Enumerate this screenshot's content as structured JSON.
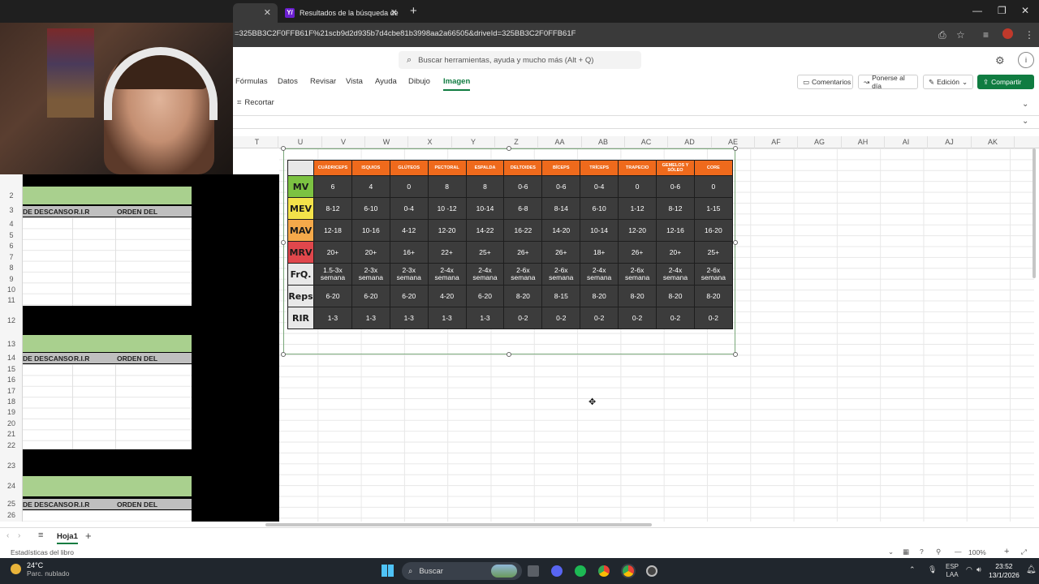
{
  "browser": {
    "tabs": [
      {
        "label": ""
      },
      {
        "label": "Resultados de la búsqueda de"
      }
    ],
    "url": "=325BB3C2F0FFB61F%21scb9d2d935b7d4cbe81b3998aa2a66505&driveId=325BB3C2F0FFB61F"
  },
  "excel": {
    "search_placeholder": "Buscar herramientas, ayuda y mucho más (Alt + Q)",
    "menu": [
      "Fórmulas",
      "Datos",
      "Revisar",
      "Vista",
      "Ayuda",
      "Dibujo",
      "Imagen"
    ],
    "buttons": {
      "comments": "Comentarios",
      "catchup": "Ponerse al día",
      "editing": "Edición",
      "share": "Compartir"
    },
    "crop": "Recortar",
    "columns": [
      "T",
      "U",
      "V",
      "W",
      "X",
      "Y",
      "Z",
      "AA",
      "AB",
      "AC",
      "AD",
      "AE",
      "AF",
      "AG",
      "AH",
      "AI",
      "AJ",
      "AK"
    ],
    "rows": [
      "2",
      "3",
      "4",
      "5",
      "6",
      "7",
      "8",
      "9",
      "10",
      "11",
      "12",
      "13",
      "14",
      "15",
      "16",
      "17",
      "18",
      "19",
      "20",
      "21",
      "22",
      "23",
      "24",
      "25",
      "26"
    ],
    "left_headers": {
      "descanso": "DE DESCANSO",
      "rir": "R.I.R",
      "orden": "ORDEN DEL EJERCICIO"
    },
    "sheet_tab": "Hoja1",
    "status_left": "Estadísticas del libro",
    "zoom": "100%"
  },
  "volume_table": {
    "headers": [
      "CUÁDRICEPS",
      "ISQUIOS",
      "GLÚTEOS",
      "PECTORAL",
      "ESPALDA",
      "DELTOIDES",
      "BÍCEPS",
      "TRÍCEPS",
      "TRAPECIO",
      "GEMELOS Y SÓLEO",
      "CORE"
    ],
    "rows": [
      {
        "label": "MV",
        "color": "#7cc242",
        "values": [
          "6",
          "4",
          "0",
          "8",
          "8",
          "0-6",
          "0-6",
          "0-4",
          "0",
          "0-6",
          "0"
        ]
      },
      {
        "label": "MEV",
        "color": "#f3e24a",
        "values": [
          "8-12",
          "6-10",
          "0-4",
          "10 -12",
          "10-14",
          "6-8",
          "8-14",
          "6-10",
          "1-12",
          "8-12",
          "1-15"
        ]
      },
      {
        "label": "MAV",
        "color": "#f5a94a",
        "values": [
          "12-18",
          "10-16",
          "4-12",
          "12-20",
          "14-22",
          "16-22",
          "14-20",
          "10-14",
          "12-20",
          "12-16",
          "16-20"
        ]
      },
      {
        "label": "MRV",
        "color": "#e0474c",
        "values": [
          "20+",
          "20+",
          "16+",
          "22+",
          "25+",
          "26+",
          "26+",
          "18+",
          "26+",
          "20+",
          "25+"
        ]
      },
      {
        "label": "FrQ.",
        "color": "#e8e8e8",
        "values": [
          "1.5-3x semana",
          "2-3x semana",
          "2-3x semana",
          "2-4x semana",
          "2-4x semana",
          "2-6x semana",
          "2-6x semana",
          "2-4x semana",
          "2-6x semana",
          "2-4x semana",
          "2-6x semana"
        ]
      },
      {
        "label": "Reps",
        "color": "#e8e8e8",
        "values": [
          "6-20",
          "6-20",
          "6-20",
          "4-20",
          "6-20",
          "8-20",
          "8-15",
          "8-20",
          "8-20",
          "8-20",
          "8-20"
        ]
      },
      {
        "label": "RIR",
        "color": "#e8e8e8",
        "values": [
          "1-3",
          "1-3",
          "1-3",
          "1-3",
          "1-3",
          "0-2",
          "0-2",
          "0-2",
          "0-2",
          "0-2",
          "0-2"
        ]
      }
    ]
  },
  "taskbar": {
    "temp": "24°C",
    "weather": "Parc. nublado",
    "search": "Buscar",
    "lang1": "ESP",
    "lang2": "LAA",
    "time": "23:52",
    "date": "13/1/2026"
  }
}
